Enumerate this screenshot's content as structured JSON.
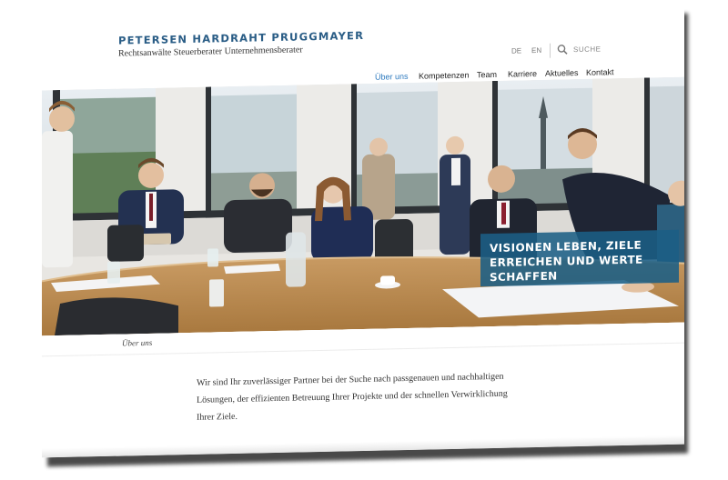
{
  "brand": {
    "name": "PETERSEN HARDRAHT PRUGGMAYER",
    "tagline": "Rechtsanwälte Steuerberater Unternehmensberater"
  },
  "utility": {
    "lang_de": "DE",
    "lang_en": "EN",
    "search_label": "SUCHE"
  },
  "nav": {
    "items": [
      {
        "label": "Über uns",
        "active": true
      },
      {
        "label": "Kompetenzen"
      },
      {
        "label": "Team"
      },
      {
        "label": "Karriere"
      },
      {
        "label": "Aktuelles"
      },
      {
        "label": "Kontakt"
      }
    ]
  },
  "hero": {
    "headline": "VISIONEN LEBEN, ZIELE ERREICHEN UND WERTE SCHAFFEN",
    "image": "meeting-room-photo"
  },
  "breadcrumb": "Über uns",
  "intro": "Wir sind Ihr zuverlässiger Partner bei der Suche nach passgenauen und nachhaltigen Lösungen, der effizienten Betreuung Ihrer Projekte und der schnellen Verwirklichung Ihrer Ziele.",
  "colors": {
    "brand_blue": "#2a5d86",
    "nav_active": "#2f7bbf",
    "caption_bg": "#1b5f85"
  }
}
